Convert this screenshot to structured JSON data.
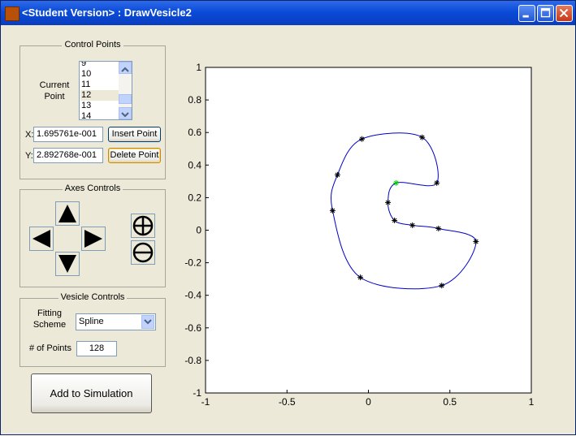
{
  "window": {
    "title": "<Student Version> : DrawVesicle2",
    "buttons": [
      "minimize",
      "maximize",
      "close"
    ]
  },
  "control_points": {
    "title": "Control Points",
    "current_point_label": "Current\nPoint",
    "list_items": [
      "9",
      "10",
      "11",
      "12",
      "13",
      "14"
    ],
    "selected_item": "12",
    "x_label": "X:",
    "x_value": "1.695761e-001",
    "y_label": "Y:",
    "y_value": "2.892768e-001",
    "insert_button": "Insert Point",
    "delete_button": "Delete Point"
  },
  "axes_controls": {
    "title": "Axes Controls",
    "icons": [
      "arrow-up-icon",
      "arrow-left-icon",
      "arrow-right-icon",
      "arrow-down-icon",
      "zoom-in-icon",
      "zoom-out-icon"
    ]
  },
  "vesicle_controls": {
    "title": "Vesicle Controls",
    "fitting_label": "Fitting\nScheme",
    "fitting_value": "Spline",
    "points_label": "# of Points",
    "points_value": "128"
  },
  "simulation_button": "Add to Simulation",
  "chart_data": {
    "type": "line",
    "title": "",
    "xlabel": "",
    "ylabel": "",
    "xlim": [
      -1,
      1
    ],
    "ylim": [
      -1,
      1
    ],
    "x_ticks": [
      -1,
      -0.5,
      0,
      0.5,
      1
    ],
    "x_tick_labels": [
      "-1",
      "-0.5",
      "0",
      "0.5",
      "1"
    ],
    "y_ticks": [
      -1,
      -0.8,
      -0.6,
      -0.4,
      -0.2,
      0,
      0.2,
      0.4,
      0.6,
      0.8,
      1
    ],
    "y_tick_labels": [
      "-1",
      "-0.8",
      "-0.6",
      "-0.4",
      "-0.2",
      "0",
      "0.2",
      "0.4",
      "0.6",
      "0.8",
      "1"
    ],
    "grid": false,
    "curve_color": "#0000C8",
    "marker_color": "#000000",
    "selected_color": "#00D000",
    "control_points": [
      {
        "x": 0.17,
        "y": 0.29
      },
      {
        "x": 0.42,
        "y": 0.29
      },
      {
        "x": 0.33,
        "y": 0.57
      },
      {
        "x": -0.04,
        "y": 0.56
      },
      {
        "x": -0.19,
        "y": 0.34
      },
      {
        "x": -0.22,
        "y": 0.12
      },
      {
        "x": -0.05,
        "y": -0.29
      },
      {
        "x": 0.45,
        "y": -0.34
      },
      {
        "x": 0.66,
        "y": -0.07
      },
      {
        "x": 0.43,
        "y": 0.01
      },
      {
        "x": 0.27,
        "y": 0.03
      },
      {
        "x": 0.16,
        "y": 0.06
      },
      {
        "x": 0.12,
        "y": 0.17
      }
    ],
    "selected_index": 0
  }
}
